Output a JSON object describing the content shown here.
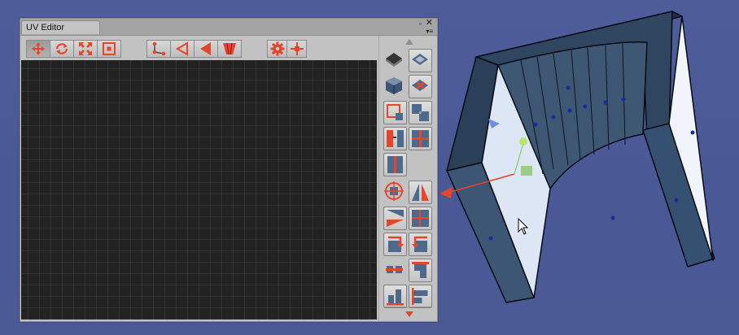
{
  "window": {
    "tab_title": "UV Editor",
    "maximize_glyph": "▫",
    "close_glyph": "✕",
    "menu_glyph": "▾≡"
  },
  "toolbar": {
    "transform_tools": [
      {
        "icon": "move-arrows-icon",
        "active": true
      },
      {
        "icon": "rotate-icon",
        "active": false
      },
      {
        "icon": "scale-icon",
        "active": false
      },
      {
        "icon": "rect-select-icon",
        "active": false
      }
    ],
    "selection_modes": [
      {
        "icon": "vertex-mode-icon"
      },
      {
        "icon": "edge-mode-icon"
      },
      {
        "icon": "face-mode-icon"
      },
      {
        "icon": "element-mode-icon"
      }
    ],
    "extras": [
      {
        "icon": "gear-icon"
      },
      {
        "icon": "pivot-icon"
      }
    ]
  },
  "colors": {
    "accent_red": "#e6452c",
    "panel_gray": "#c2c2c2",
    "viewport_dark": "#222222",
    "scene_blue": "#4b5a96"
  },
  "side_tools": [
    "project-planar-icon",
    "project-box-icon",
    "fit-uv-icon",
    "stitch-icon",
    "align-uvs-icon",
    "split-uvs-icon",
    "weld-icon",
    "center-uvs-icon",
    "flip-horizontal-icon",
    "flip-vertical-icon",
    "rotate-left-icon",
    "rotate-right-icon",
    "align-horizontal-icon",
    "align-vertical-icon",
    "snap-bottom-icon",
    "snap-left-icon"
  ]
}
